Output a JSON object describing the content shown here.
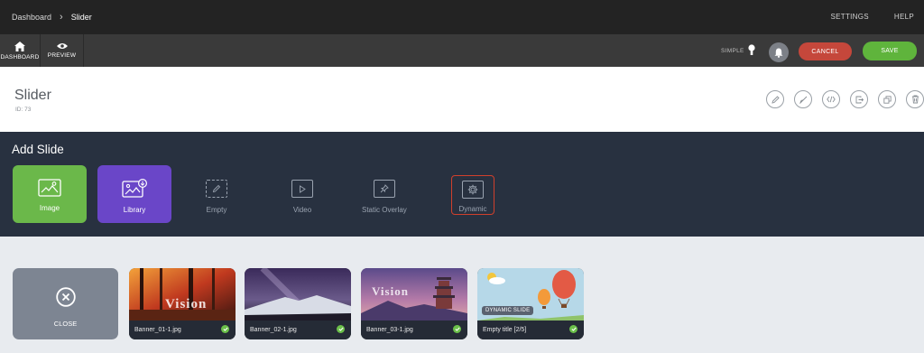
{
  "breadcrumb": {
    "root": "Dashboard",
    "current": "Slider"
  },
  "topnav": {
    "settings": "SETTINGS",
    "help": "HELP"
  },
  "toolbar": {
    "dashboard_label": "DASHBOARD",
    "preview_label": "PREVIEW",
    "mode_label": "SIMPLE",
    "cancel_label": "CANCEL",
    "save_label": "SAVE"
  },
  "page": {
    "title": "Slider",
    "id": "ID: 73"
  },
  "title_actions": [
    "edit-icon",
    "brush-icon",
    "code-icon",
    "export-icon",
    "duplicate-icon",
    "trash-icon"
  ],
  "add_slide": {
    "heading": "Add Slide",
    "image_label": "Image",
    "library_label": "Library",
    "empty_label": "Empty",
    "video_label": "Video",
    "overlay_label": "Static Overlay",
    "dynamic_label": "Dynamic"
  },
  "slides": {
    "close_label": "CLOSE",
    "items": [
      {
        "name": "Banner_01-1.jpg",
        "watermark": "Vision"
      },
      {
        "name": "Banner_02-1.jpg"
      },
      {
        "name": "Banner_03-1.jpg",
        "watermark": "Vision"
      },
      {
        "name": "Empty title [2/5]",
        "badge": "DYNAMIC SLIDE"
      }
    ]
  },
  "colors": {
    "cancel": "#c5473b",
    "save": "#5fb43c",
    "image_tile": "#6bb84a",
    "library_tile": "#6a46c8",
    "dynamic_highlight": "#d0402c",
    "check": "#6bc04a"
  }
}
